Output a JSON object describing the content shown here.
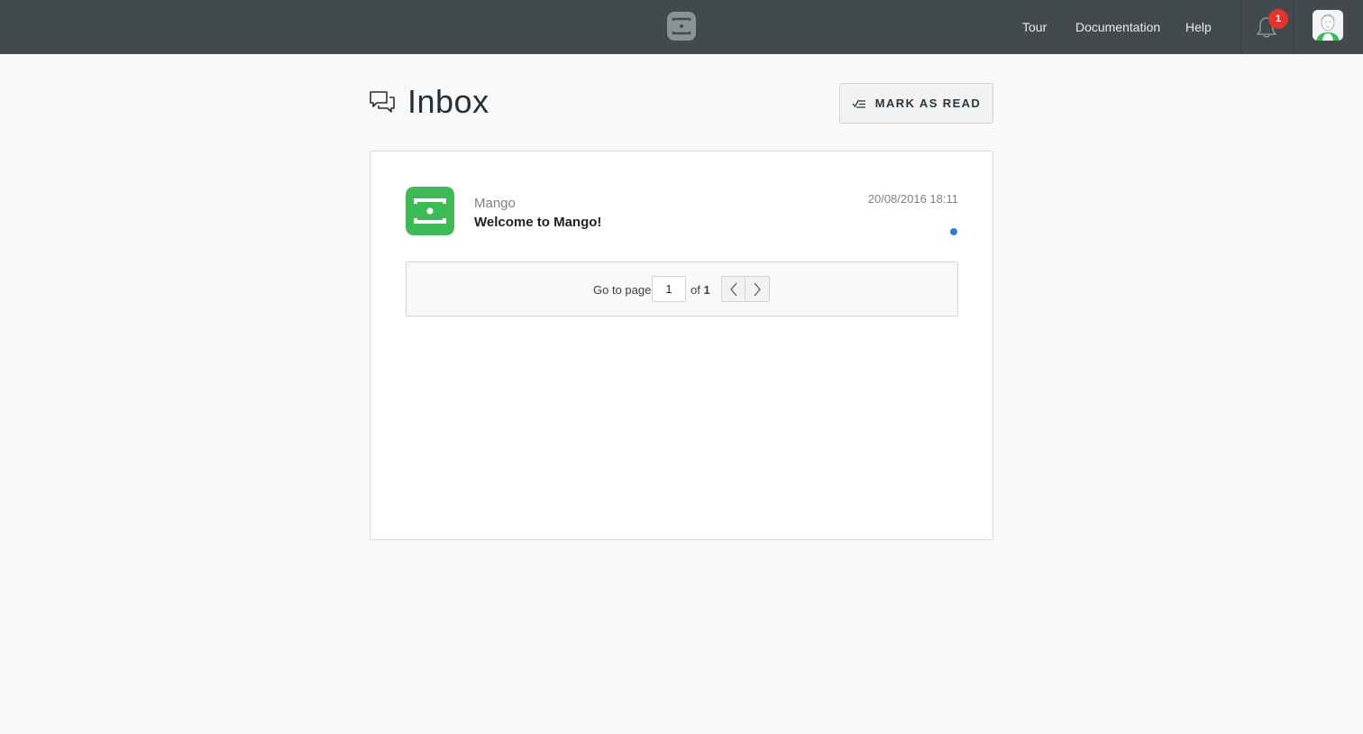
{
  "header": {
    "nav": [
      {
        "label": "Tour"
      },
      {
        "label": "Documentation"
      },
      {
        "label": "Help"
      }
    ],
    "notifications": {
      "count": "1",
      "icon": "bell-icon"
    },
    "avatar_icon": "user-avatar-icon",
    "logo_icon": "mango-logo-icon"
  },
  "page": {
    "title": "Inbox",
    "title_icon": "chat-bubbles-icon",
    "mark_read_label": "MARK AS READ",
    "mark_read_icon": "check-list-icon"
  },
  "messages": [
    {
      "sender": "Mango",
      "subject": "Welcome to Mango!",
      "date": "20/08/2016 18:11",
      "unread": true,
      "icon": "mango-app-icon"
    }
  ],
  "pagination": {
    "goto_label": "Go to page",
    "current_page": "1",
    "of_label": "of",
    "total_pages": "1"
  },
  "colors": {
    "topbar": "#424a4e",
    "brand_green": "#3dba55",
    "badge_red": "#e5342f",
    "unread_dot": "#2d7fd0",
    "background": "#f8f9fa"
  }
}
